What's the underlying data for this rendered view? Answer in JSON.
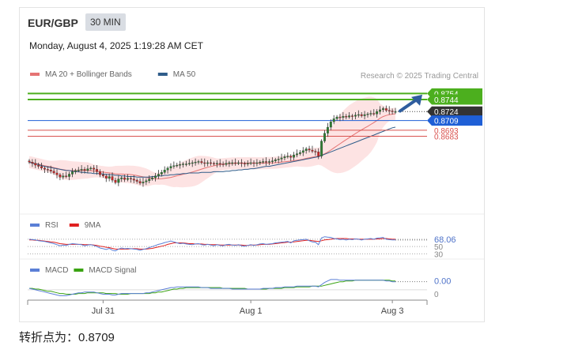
{
  "header": {
    "symbol": "EUR/GBP",
    "timeframe": "30 MIN",
    "datetime": "Monday, August 4, 2025 1:19:28 AM CET"
  },
  "footer": {
    "pivot_text": "转折点为：0.8709"
  },
  "chart_data": [
    {
      "type": "candlestick",
      "panel": "price",
      "legend": [
        {
          "name": "MA 20 + Bollinger Bands",
          "color": "#e57373"
        },
        {
          "name": "MA 50",
          "color": "#2f5d8a"
        }
      ],
      "credit": "Research © 2025 Trading Central",
      "ylim": [
        0.8555,
        0.8765
      ],
      "x_ticks": [
        {
          "label": "Jul 31",
          "index": 24
        },
        {
          "label": "Aug 1",
          "index": 72
        },
        {
          "label": "Aug 3",
          "index": 118
        }
      ],
      "close": [
        0.864,
        0.8638,
        0.8635,
        0.8633,
        0.863,
        0.8628,
        0.8627,
        0.8625,
        0.8622,
        0.8619,
        0.8615,
        0.8617,
        0.8616,
        0.862,
        0.8624,
        0.8626,
        0.8627,
        0.8628,
        0.8626,
        0.8629,
        0.863,
        0.8628,
        0.8624,
        0.8619,
        0.8617,
        0.8613,
        0.8616,
        0.861,
        0.8606,
        0.8612,
        0.8614,
        0.8611,
        0.8613,
        0.8612,
        0.861,
        0.8608,
        0.8605,
        0.8607,
        0.8609,
        0.8612,
        0.8614,
        0.8617,
        0.862,
        0.8623,
        0.8627,
        0.863,
        0.8633,
        0.8634,
        0.8635,
        0.8636,
        0.8637,
        0.8637,
        0.8638,
        0.8639,
        0.864,
        0.8641,
        0.8639,
        0.8638,
        0.8639,
        0.8638,
        0.8637,
        0.8638,
        0.8637,
        0.8636,
        0.8638,
        0.8639,
        0.8639,
        0.8638,
        0.8639,
        0.8638,
        0.8637,
        0.8638,
        0.8639,
        0.8638,
        0.8639,
        0.864,
        0.8641,
        0.864,
        0.8641,
        0.8642,
        0.8644,
        0.8645,
        0.8647,
        0.8649,
        0.865,
        0.8648,
        0.8652,
        0.8654,
        0.8656,
        0.8659,
        0.8662,
        0.866,
        0.8658,
        0.8657,
        0.865,
        0.8675,
        0.8688,
        0.8698,
        0.8707,
        0.8712,
        0.8715,
        0.8714,
        0.8716,
        0.8715,
        0.8717,
        0.8716,
        0.8718,
        0.8719,
        0.8717,
        0.8719,
        0.872,
        0.8721,
        0.872,
        0.8724,
        0.8727,
        0.8729,
        0.8726,
        0.8725,
        0.8724,
        0.8724
      ],
      "ma50": [
        0.864,
        0.8638,
        0.8637,
        0.8636,
        0.8634,
        0.8633,
        0.8632,
        0.8631,
        0.863,
        0.8629,
        0.8628,
        0.8627,
        0.8626,
        0.8626,
        0.8625,
        0.8624,
        0.8624,
        0.8623,
        0.8623,
        0.8622,
        0.8622,
        0.8621,
        0.8621,
        0.8621,
        0.862,
        0.862,
        0.8619,
        0.8619,
        0.8618,
        0.8618,
        0.8617,
        0.8617,
        0.8616,
        0.8616,
        0.8616,
        0.8615,
        0.8615,
        0.8615,
        0.8615,
        0.8615,
        0.8616,
        0.8616,
        0.8617,
        0.8617,
        0.8618,
        0.8618,
        0.8619,
        0.8619,
        0.862,
        0.862,
        0.8621,
        0.8621,
        0.8622,
        0.8622,
        0.8622,
        0.8622,
        0.8623,
        0.8623,
        0.8623,
        0.8623,
        0.8624,
        0.8624,
        0.8624,
        0.8624,
        0.8625,
        0.8625,
        0.8626,
        0.8626,
        0.8627,
        0.8627,
        0.8628,
        0.8628,
        0.8629,
        0.8629,
        0.863,
        0.8631,
        0.8632,
        0.8633,
        0.8633,
        0.8634,
        0.8635,
        0.8636,
        0.8637,
        0.8638,
        0.8639,
        0.864,
        0.8641,
        0.8642,
        0.8643,
        0.8644,
        0.8645,
        0.8646,
        0.8647,
        0.8648,
        0.8649,
        0.8651,
        0.8653,
        0.8655,
        0.8657,
        0.8659,
        0.8661,
        0.8663,
        0.8665,
        0.8667,
        0.8669,
        0.8671,
        0.8673,
        0.8675,
        0.8677,
        0.8679,
        0.8681,
        0.8683,
        0.8685,
        0.8687,
        0.8689,
        0.8691,
        0.8693,
        0.8695,
        0.8697,
        0.8698
      ],
      "levels": [
        {
          "value": 0.8754,
          "label": "0.8754",
          "style": "resistance",
          "color": "#4caf1e"
        },
        {
          "value": 0.8744,
          "label": "0.8744",
          "style": "resistance",
          "color": "#4caf1e"
        },
        {
          "value": 0.8724,
          "label": "0.8724",
          "style": "current",
          "color": "#333333"
        },
        {
          "value": 0.8709,
          "label": "0.8709",
          "style": "pivot",
          "color": "#1f5fd6"
        },
        {
          "value": 0.8693,
          "label": "0.8693",
          "style": "support",
          "color": "#d9534f"
        },
        {
          "value": 0.8683,
          "label": "0.8683",
          "style": "support",
          "color": "#d9534f"
        }
      ],
      "target_arrow": {
        "direction": "up",
        "color": "#2f5d9e"
      }
    },
    {
      "type": "line",
      "panel": "rsi",
      "legend": [
        {
          "name": "RSI",
          "color": "#5b7fd6"
        },
        {
          "name": "9MA",
          "color": "#e02020"
        }
      ],
      "levels": [
        70,
        50,
        30
      ],
      "ylim": [
        20,
        85
      ],
      "last_value_label": "68.06",
      "rsi": [
        70,
        69,
        68,
        66,
        65,
        64,
        62,
        60,
        58,
        55,
        52,
        54,
        53,
        56,
        58,
        57,
        56,
        55,
        52,
        54,
        55,
        53,
        50,
        46,
        44,
        42,
        45,
        40,
        38,
        43,
        46,
        44,
        45,
        44,
        43,
        42,
        40,
        42,
        44,
        47,
        50,
        53,
        56,
        58,
        61,
        63,
        65,
        63,
        60,
        58,
        59,
        57,
        56,
        55,
        57,
        58,
        55,
        54,
        56,
        54,
        52,
        55,
        53,
        52,
        55,
        56,
        54,
        53,
        55,
        52,
        51,
        53,
        55,
        53,
        55,
        57,
        58,
        56,
        57,
        58,
        60,
        61,
        62,
        63,
        64,
        60,
        66,
        67,
        68,
        69,
        70,
        66,
        63,
        62,
        55,
        74,
        77,
        76,
        75,
        72,
        71,
        69,
        70,
        68,
        70,
        69,
        71,
        70,
        68,
        70,
        71,
        72,
        70,
        73,
        74,
        75,
        70,
        69,
        68,
        68
      ],
      "ma9": [
        68,
        68,
        67,
        67,
        66,
        65,
        64,
        63,
        62,
        60,
        58,
        57,
        56,
        56,
        56,
        56,
        56,
        56,
        55,
        55,
        55,
        54,
        53,
        51,
        50,
        48,
        47,
        45,
        43,
        43,
        43,
        43,
        43,
        44,
        44,
        44,
        43,
        43,
        43,
        44,
        45,
        47,
        49,
        51,
        53,
        56,
        58,
        60,
        60,
        60,
        60,
        59,
        58,
        58,
        57,
        57,
        57,
        56,
        56,
        55,
        55,
        55,
        54,
        54,
        54,
        54,
        54,
        54,
        54,
        54,
        53,
        53,
        54,
        54,
        54,
        55,
        56,
        56,
        56,
        57,
        58,
        59,
        60,
        61,
        62,
        62,
        63,
        64,
        65,
        66,
        67,
        67,
        66,
        65,
        64,
        66,
        68,
        69,
        70,
        71,
        72,
        72,
        72,
        72,
        71,
        71,
        71,
        70,
        70,
        70,
        70,
        70,
        70,
        71,
        71,
        72,
        72,
        71,
        70,
        70
      ]
    },
    {
      "type": "line",
      "panel": "macd",
      "legend": [
        {
          "name": "MACD",
          "color": "#5b7fd6"
        },
        {
          "name": "MACD Signal",
          "color": "#3aa312"
        }
      ],
      "zero_label": "0",
      "last_value_label": "0.00",
      "ylim": [
        -0.0014,
        0.0016
      ],
      "macd": [
        0.0002,
        0.0001,
        0.0,
        -0.0001,
        -0.0002,
        -0.0003,
        -0.0004,
        -0.0005,
        -0.0006,
        -0.0007,
        -0.0008,
        -0.0008,
        -0.0008,
        -0.0007,
        -0.0006,
        -0.0005,
        -0.0004,
        -0.0004,
        -0.0003,
        -0.0003,
        -0.0003,
        -0.0003,
        -0.0004,
        -0.0005,
        -0.0006,
        -0.0006,
        -0.0006,
        -0.0007,
        -0.0007,
        -0.0006,
        -0.0005,
        -0.0005,
        -0.0005,
        -0.0005,
        -0.0005,
        -0.0005,
        -0.0005,
        -0.0005,
        -0.0004,
        -0.0004,
        -0.0003,
        -0.0002,
        -0.0001,
        0.0,
        0.0001,
        0.0002,
        0.0003,
        0.0003,
        0.0004,
        0.0004,
        0.0004,
        0.0004,
        0.0004,
        0.0004,
        0.0004,
        0.0004,
        0.0003,
        0.0003,
        0.0003,
        0.0002,
        0.0002,
        0.0002,
        0.0002,
        0.0002,
        0.0002,
        0.0002,
        0.0001,
        0.0001,
        0.0001,
        0.0001,
        0.0001,
        0.0001,
        0.0001,
        0.0001,
        0.0001,
        0.0001,
        0.0002,
        0.0002,
        0.0002,
        0.0002,
        0.0003,
        0.0003,
        0.0003,
        0.0004,
        0.0004,
        0.0004,
        0.0004,
        0.0005,
        0.0005,
        0.0005,
        0.0005,
        0.0005,
        0.0005,
        0.0005,
        0.0004,
        0.0007,
        0.001,
        0.0012,
        0.0014,
        0.0014,
        0.0014,
        0.0013,
        0.0013,
        0.0013,
        0.0013,
        0.0013,
        0.0013,
        0.0013,
        0.0013,
        0.0013,
        0.0013,
        0.0013,
        0.0013,
        0.0013,
        0.0013,
        0.0013,
        0.0012,
        0.0012,
        0.0011,
        0.0011
      ],
      "signal": [
        0.0002,
        0.0002,
        0.0001,
        0.0001,
        0.0,
        -0.0001,
        -0.0002,
        -0.0002,
        -0.0003,
        -0.0004,
        -0.0005,
        -0.0005,
        -0.0006,
        -0.0006,
        -0.0006,
        -0.0006,
        -0.0005,
        -0.0005,
        -0.0005,
        -0.0004,
        -0.0004,
        -0.0004,
        -0.0004,
        -0.0004,
        -0.0004,
        -0.0005,
        -0.0005,
        -0.0005,
        -0.0005,
        -0.0006,
        -0.0006,
        -0.0006,
        -0.0006,
        -0.0005,
        -0.0005,
        -0.0005,
        -0.0005,
        -0.0005,
        -0.0005,
        -0.0005,
        -0.0004,
        -0.0004,
        -0.0003,
        -0.0003,
        -0.0002,
        -0.0001,
        0.0,
        0.0001,
        0.0001,
        0.0002,
        0.0002,
        0.0003,
        0.0003,
        0.0003,
        0.0003,
        0.0003,
        0.0003,
        0.0003,
        0.0003,
        0.0003,
        0.0003,
        0.0003,
        0.0003,
        0.0002,
        0.0002,
        0.0002,
        0.0002,
        0.0002,
        0.0002,
        0.0002,
        0.0002,
        0.0001,
        0.0001,
        0.0001,
        0.0001,
        0.0001,
        0.0001,
        0.0001,
        0.0002,
        0.0002,
        0.0002,
        0.0002,
        0.0002,
        0.0003,
        0.0003,
        0.0003,
        0.0003,
        0.0004,
        0.0004,
        0.0004,
        0.0004,
        0.0004,
        0.0005,
        0.0005,
        0.0005,
        0.0005,
        0.0006,
        0.0007,
        0.0008,
        0.0009,
        0.001,
        0.0011,
        0.0011,
        0.0012,
        0.0012,
        0.0012,
        0.0013,
        0.0013,
        0.0013,
        0.0013,
        0.0013,
        0.0013,
        0.0013,
        0.0013,
        0.0013,
        0.0013,
        0.0013,
        0.0013,
        0.0012,
        0.0012
      ]
    }
  ]
}
